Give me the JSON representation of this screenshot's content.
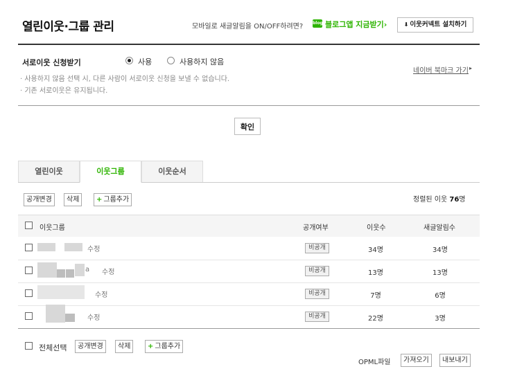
{
  "header": {
    "title": "열린이웃·그룹 관리",
    "mobile_note": "모바일로 새글알림을 ON/OFF하려면?",
    "blog_app_badge": "blog",
    "blog_app_link": "블로그앱 지금받기›",
    "connect_button_icon": "⬇",
    "connect_button": "이웃커넥트 설치하기"
  },
  "neighbor_request": {
    "label": "서로이웃 신청받기",
    "options": [
      "사용",
      "사용하지 않음"
    ],
    "selected": "사용",
    "help_lines": [
      "· 사용하지 않음 선택 시, 다른 사람이 서로이웃 신청을 보낼 수 없습니다.",
      "· 기존 서로이웃은 유지됩니다."
    ],
    "bookmark_link": "네이버 북마크 가기",
    "bookmark_arrow": "▸",
    "confirm_button": "확인"
  },
  "tabs": [
    {
      "label": "열린이웃",
      "active": false
    },
    {
      "label": "이웃그룹",
      "active": true
    },
    {
      "label": "이웃순서",
      "active": false
    }
  ],
  "toolbar": {
    "visibility_button": "공개변경",
    "delete_button": "삭제",
    "add_group_button": "그룹추가",
    "count_prefix": "정렬된 이웃",
    "count_value": "76",
    "count_suffix": "명"
  },
  "table": {
    "headers": [
      "이웃그룹",
      "공개여부",
      "이웃수",
      "새글알림수"
    ],
    "rows": [
      {
        "edit": "수정",
        "visibility": "비공개",
        "neighbors": "34명",
        "alerts": "34명"
      },
      {
        "edit": "수정",
        "visibility": "비공개",
        "neighbors": "13명",
        "alerts": "13명"
      },
      {
        "edit": "수정",
        "visibility": "비공개",
        "neighbors": "7명",
        "alerts": "6명"
      },
      {
        "edit": "수정",
        "visibility": "비공개",
        "neighbors": "22명",
        "alerts": "3명"
      }
    ],
    "row2_fragment": "a"
  },
  "footer": {
    "select_all": "전체선택",
    "visibility_button": "공개변경",
    "delete_button": "삭제",
    "add_group_button": "그룹추가",
    "opml_label": "OPML파일",
    "import_button": "가져오기",
    "export_button": "내보내기"
  },
  "colors": {
    "accent": "#2db400"
  }
}
